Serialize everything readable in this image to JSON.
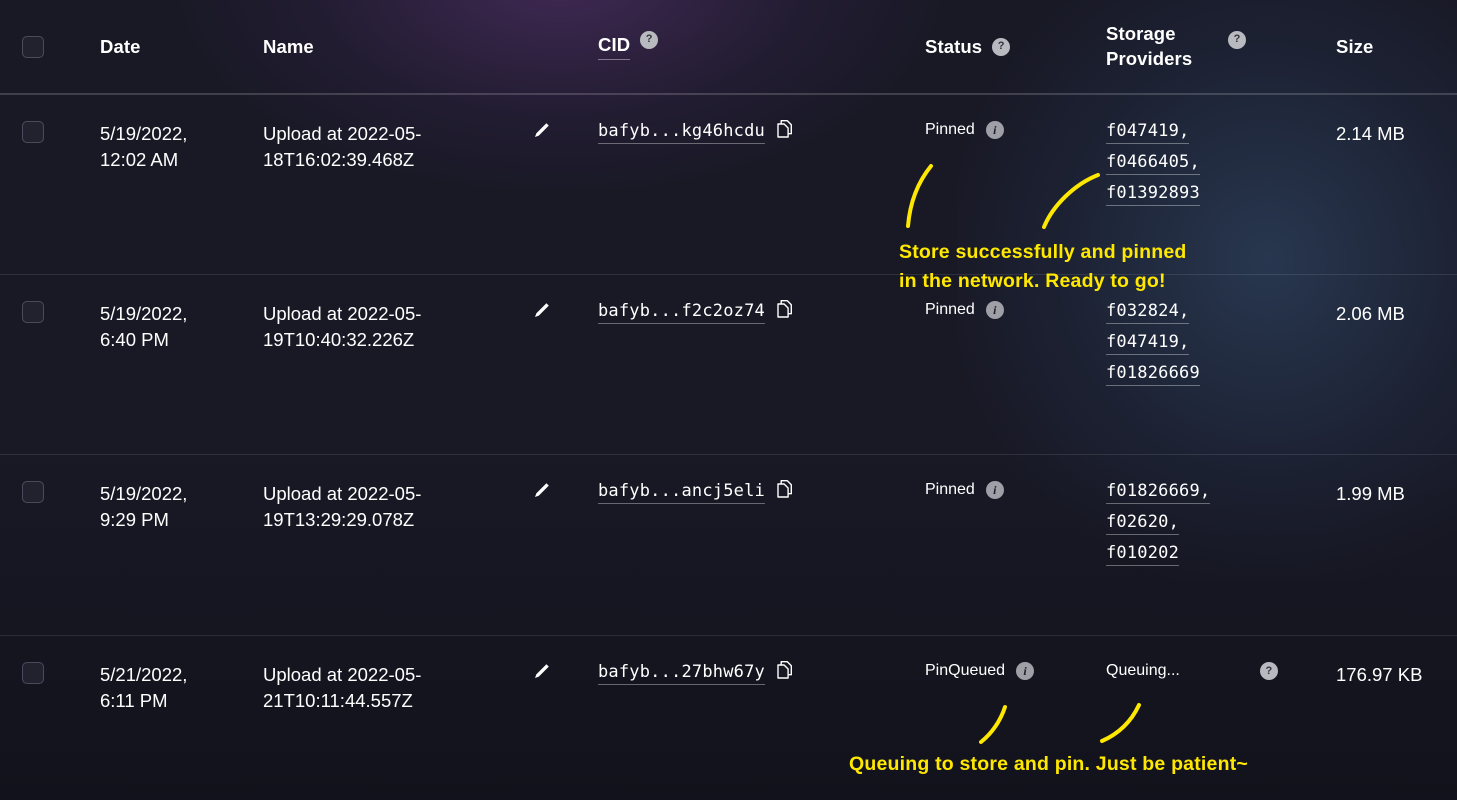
{
  "theme": {
    "background": "#191926",
    "text": "#ffffff",
    "annotation_color": "#ffe800",
    "divider": "rgba(255,255,255,0.10)"
  },
  "table": {
    "columns": [
      {
        "key": "select",
        "label": "",
        "tooltip": false
      },
      {
        "key": "date",
        "label": "Date",
        "tooltip": false
      },
      {
        "key": "name",
        "label": "Name",
        "tooltip": false
      },
      {
        "key": "cid",
        "label": "CID",
        "tooltip": true,
        "tooltip_icon": "help-icon"
      },
      {
        "key": "status",
        "label": "Status",
        "tooltip": true,
        "tooltip_icon": "help-icon"
      },
      {
        "key": "storage_providers",
        "label": "Storage Providers",
        "tooltip": true,
        "tooltip_icon": "help-icon"
      },
      {
        "key": "size",
        "label": "Size",
        "tooltip": false
      }
    ],
    "rows": [
      {
        "selected": false,
        "date": "5/19/2022, 12:02 AM",
        "name": "Upload at 2022-05-18T16:02:39.468Z",
        "cid": "bafyb...kg46hcdu",
        "status": "Pinned",
        "status_icon": "info-icon",
        "storage_providers": [
          "f047419,",
          "f0466405,",
          "f01392893"
        ],
        "size": "2.14 MB",
        "edit_icon": "pencil-icon",
        "copy_icon": "copy-icon"
      },
      {
        "selected": false,
        "date": "5/19/2022, 6:40 PM",
        "name": "Upload at 2022-05-19T10:40:32.226Z",
        "cid": "bafyb...f2c2oz74",
        "status": "Pinned",
        "status_icon": "info-icon",
        "storage_providers": [
          "f032824,",
          "f047419,",
          "f01826669"
        ],
        "size": "2.06 MB",
        "edit_icon": "pencil-icon",
        "copy_icon": "copy-icon"
      },
      {
        "selected": false,
        "date": "5/19/2022, 9:29 PM",
        "name": "Upload at 2022-05-19T13:29:29.078Z",
        "cid": "bafyb...ancj5eli",
        "status": "Pinned",
        "status_icon": "info-icon",
        "storage_providers": [
          "f01826669,",
          "f02620,",
          "f010202"
        ],
        "size": "1.99 MB",
        "edit_icon": "pencil-icon",
        "copy_icon": "copy-icon"
      },
      {
        "selected": false,
        "date": "5/21/2022, 6:11 PM",
        "name": "Upload at 2022-05-21T10:11:44.557Z",
        "cid": "bafyb...27bhw67y",
        "status": "PinQueued",
        "status_icon": "info-icon",
        "storage_providers_text": "Queuing...",
        "storage_providers_tooltip_icon": "help-icon",
        "size": "176.97 KB",
        "edit_icon": "pencil-icon",
        "copy_icon": "copy-icon"
      }
    ]
  },
  "annotations": [
    {
      "id": "pinned-note",
      "text": "Store successfully and pinned\nin the network. Ready to go!"
    },
    {
      "id": "queued-note",
      "text": "Queuing to store and pin. Just be patient~"
    }
  ]
}
